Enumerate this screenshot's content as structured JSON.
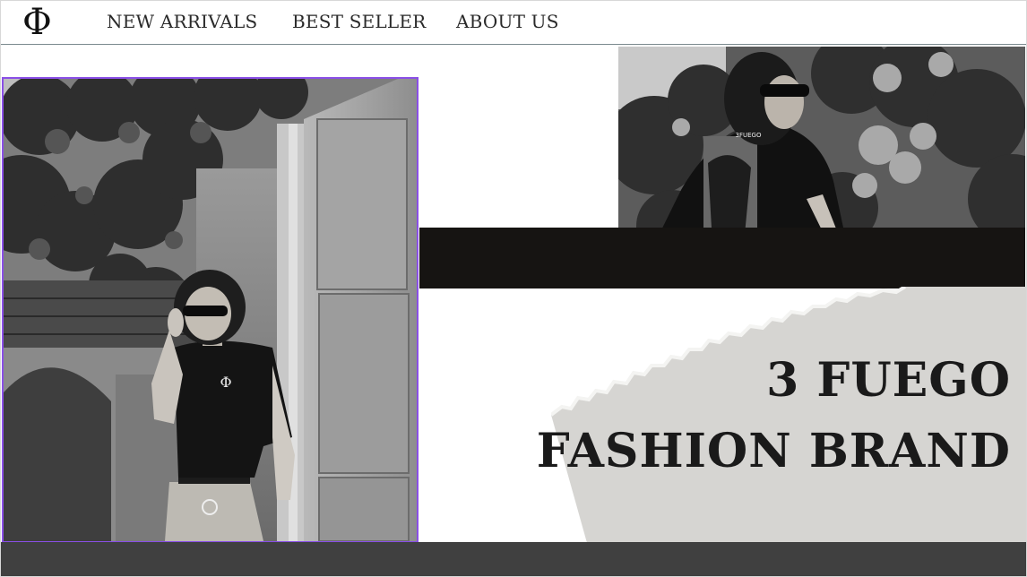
{
  "header": {
    "logo": "Φ",
    "nav": [
      "NEW ARRIVALS",
      "BEST SELLER",
      "ABOUT US"
    ]
  },
  "hero": {
    "title_line1": "3 FUEGO",
    "title_line2": "FASHION BRAND",
    "shirt_print": "3FUEGO",
    "shirt_logo": "Φ"
  },
  "colors": {
    "accent_border": "#8a4fe6",
    "band_dark": "#161412",
    "footer": "#404040",
    "paper": "#d6d5d2"
  }
}
